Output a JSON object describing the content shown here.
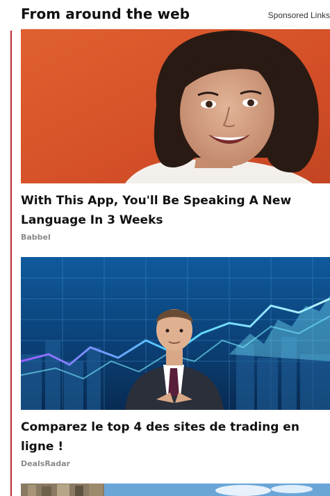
{
  "header": {
    "title": "From around the web",
    "sponsored": "Sponsored Links"
  },
  "cards": [
    {
      "title": "With This App, You'll Be Speaking A New Language In 3 Weeks",
      "source": "Babbel",
      "image": "smiling-woman-photo"
    },
    {
      "title": "Comparez le top 4 des sites de trading en ligne !",
      "source": "DealsRadar",
      "image": "businessman-trading-chart-photo"
    },
    {
      "title": "",
      "source": "",
      "image": "city-skyline-photo"
    }
  ],
  "colors": {
    "accent_rule": "#c1272d",
    "source_text": "#8a8a8a",
    "background_orange": "#d9542c",
    "background_blue": "#0d3f78"
  }
}
